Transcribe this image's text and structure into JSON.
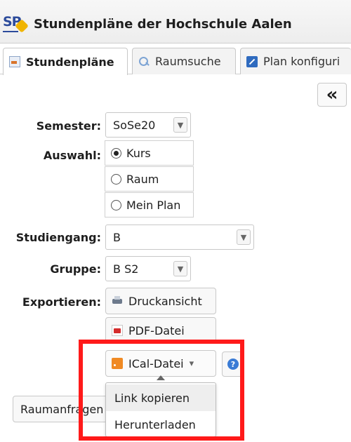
{
  "header": {
    "logo_text": "SP",
    "title": "Stundenpläne der Hochschule Aalen"
  },
  "tabs": [
    {
      "label": "Stundenpläne",
      "icon": "calendar-icon",
      "active": true
    },
    {
      "label": "Raumsuche",
      "icon": "search-icon",
      "active": false
    },
    {
      "label": "Plan konfiguri",
      "icon": "edit-icon",
      "active": false
    }
  ],
  "collapse": {
    "glyph": "«",
    "icon": "collapse-icon"
  },
  "form": {
    "semester": {
      "label": "Semester:",
      "value": "SoSe20"
    },
    "auswahl": {
      "label": "Auswahl:",
      "options": [
        {
          "label": "Kurs",
          "checked": true
        },
        {
          "label": "Raum",
          "checked": false
        },
        {
          "label": "Mein Plan",
          "checked": false
        }
      ]
    },
    "studiengang": {
      "label": "Studiengang:",
      "value": "B"
    },
    "gruppe": {
      "label": "Gruppe:",
      "value": "B S2"
    },
    "exportieren": {
      "label": "Exportieren:",
      "druck": "Druckansicht",
      "pdf": "PDF-Datei",
      "ical": "ICal-Datei",
      "help": "?"
    }
  },
  "ical_menu": {
    "items": [
      "Link kopieren",
      "Herunterladen"
    ]
  },
  "raum_button": "Raumanfragen",
  "colors": {
    "highlight": "#ff1a1a",
    "accent": "#2c4b9b"
  }
}
